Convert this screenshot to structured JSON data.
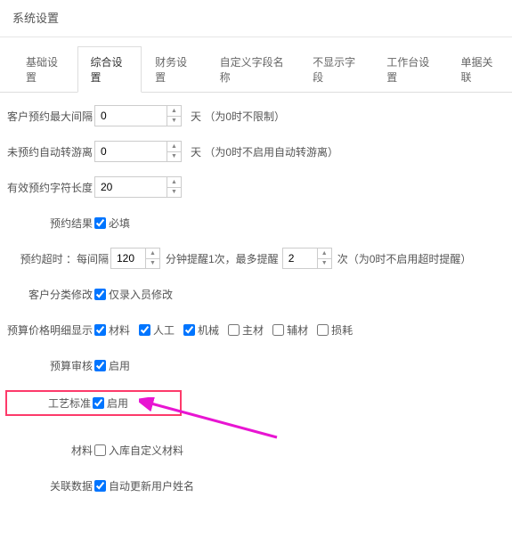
{
  "header": {
    "title": "系统设置"
  },
  "tabs": [
    {
      "label": "基础设置"
    },
    {
      "label": "综合设置"
    },
    {
      "label": "财务设置"
    },
    {
      "label": "自定义字段名称"
    },
    {
      "label": "不显示字段"
    },
    {
      "label": "工作台设置"
    },
    {
      "label": "单据关联"
    }
  ],
  "rows": {
    "max_interval": {
      "label": "客户预约最大间隔",
      "value": "0",
      "suffix": "天    （为0时不限制）"
    },
    "auto_away": {
      "label": "未预约自动转游离",
      "value": "0",
      "suffix": "天    （为0时不启用自动转游离）"
    },
    "field_length": {
      "label": "有效预约字符长度",
      "value": "20",
      "suffix": ""
    },
    "result": {
      "label": "预约结果",
      "cb": "必填"
    },
    "timeout": {
      "label": "预约超时 ：每间隔",
      "val1": "120",
      "mid": "分钟提醒1次，最多提醒",
      "val2": "2",
      "suffix": "次（为0时不启用超时提醒）"
    },
    "category_mod": {
      "label": "客户分类修改",
      "cb": "仅录入员修改"
    },
    "budget_detail": {
      "label": "预算价格明细显示",
      "opts": [
        "材料",
        "人工",
        "机械",
        "主材",
        "辅材",
        "损耗"
      ],
      "checked": [
        true,
        true,
        true,
        false,
        false,
        false
      ]
    },
    "budget_audit": {
      "label": "预算审核",
      "cb": "启用"
    },
    "craft_std": {
      "label": "工艺标准",
      "cb": "启用"
    },
    "material": {
      "label": "材料",
      "cb": "入库自定义材料"
    },
    "related_data": {
      "label": "关联数据",
      "cb": "自动更新用户姓名"
    }
  }
}
